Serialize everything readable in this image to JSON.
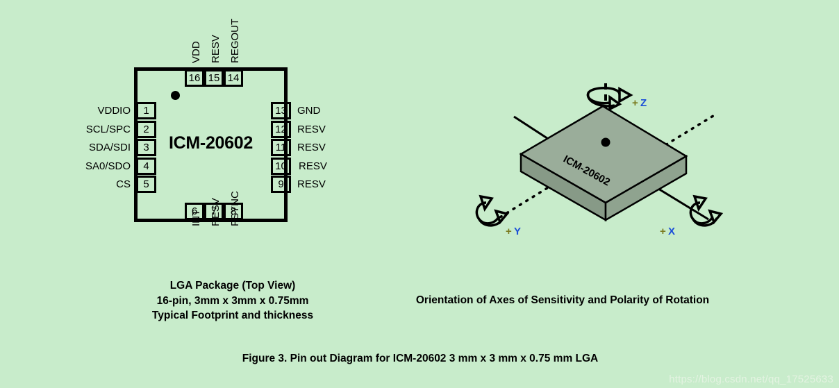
{
  "page": {
    "background_color": "#c8eccb",
    "figure_caption": "Figure 3. Pin out Diagram for ICM-20602 3 mm x 3 mm x 0.75 mm LGA",
    "watermark": "https://blog.csdn.net/qq_17525633"
  },
  "lga_view": {
    "chip_label": "ICM-20602",
    "caption_line1": "LGA Package (Top View)",
    "caption_line2": "16-pin, 3mm x 3mm x 0.75mm",
    "caption_line3": "Typical Footprint and thickness",
    "pins_left": [
      {
        "number": "1",
        "name": "VDDIO"
      },
      {
        "number": "2",
        "name": "SCL/SPC"
      },
      {
        "number": "3",
        "name": "SDA/SDI"
      },
      {
        "number": "4",
        "name": "SA0/SDO"
      },
      {
        "number": "5",
        "name": "CS"
      }
    ],
    "pins_bottom": [
      {
        "number": "6",
        "name": "INT"
      },
      {
        "number": "7",
        "name": "RESV"
      },
      {
        "number": "8",
        "name": "FSYNC"
      }
    ],
    "pins_right": [
      {
        "number": "9",
        "name": "RESV"
      },
      {
        "number": "10",
        "name": "RESV"
      },
      {
        "number": "11",
        "name": "RESV"
      },
      {
        "number": "12",
        "name": "RESV"
      },
      {
        "number": "13",
        "name": "GND"
      }
    ],
    "pins_top": [
      {
        "number": "14",
        "name": "REGOUT"
      },
      {
        "number": "15",
        "name": "RESV"
      },
      {
        "number": "16",
        "name": "VDD"
      }
    ]
  },
  "axes_view": {
    "caption": "Orientation of Axes of Sensitivity and Polarity of Rotation",
    "package_marking": "ICM-20602",
    "axes": [
      {
        "id": "z",
        "plus": "+",
        "letter": "Z"
      },
      {
        "id": "y",
        "plus": "+",
        "letter": "Y"
      },
      {
        "id": "x",
        "plus": "+",
        "letter": "X"
      }
    ],
    "colors": {
      "package_top": "#94a694",
      "package_side": "#8a9c8a",
      "plus_sign": "#7a7a1e",
      "axis_letter": "#1b4fd8",
      "outline": "#000000"
    }
  }
}
